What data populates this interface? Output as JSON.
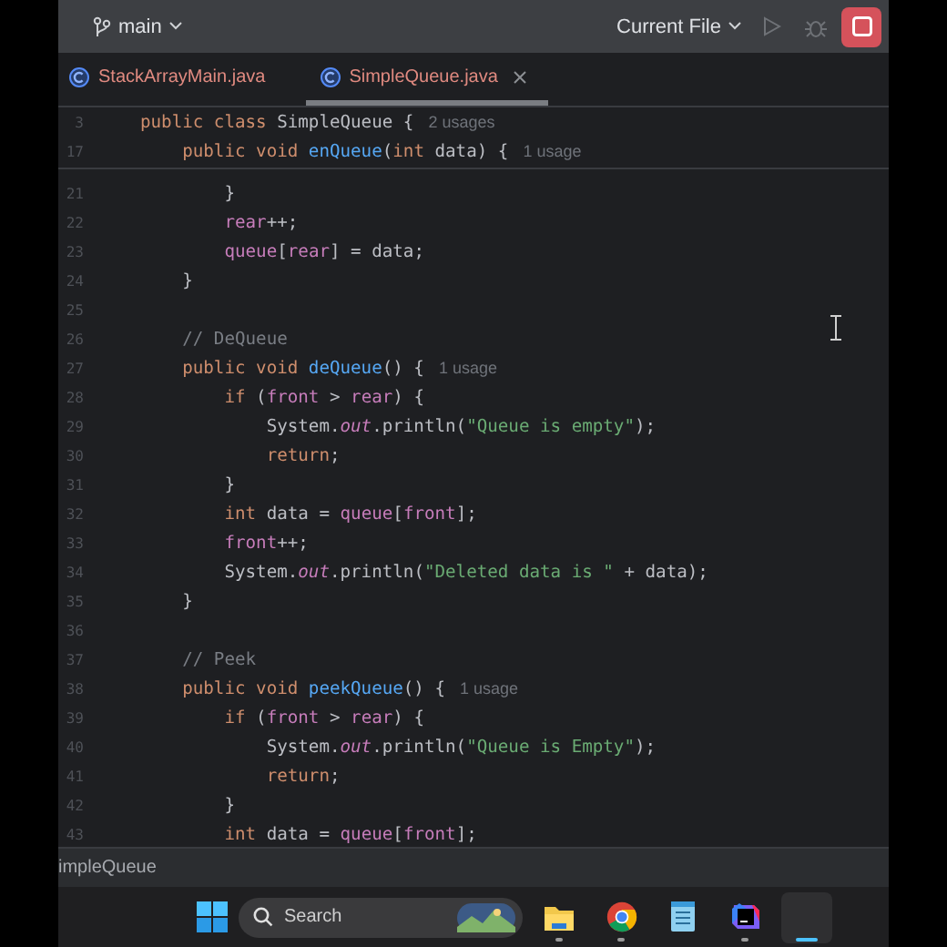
{
  "toolbar": {
    "branch": "main",
    "run_config": "Current File"
  },
  "tabs": [
    {
      "label": "StackArrayMain.java",
      "selected": false
    },
    {
      "label": "SimpleQueue.java",
      "selected": true
    }
  ],
  "sticky_lines": [
    {
      "number": "3",
      "tokens": [
        {
          "kind": "keyword",
          "text": "public class "
        },
        {
          "kind": "plain",
          "text": "SimpleQueue {"
        }
      ],
      "hint": "2 usages"
    },
    {
      "number": "17",
      "tokens": [
        {
          "kind": "keyword",
          "text": "    public void "
        },
        {
          "kind": "method",
          "text": "enQueue"
        },
        {
          "kind": "plain",
          "text": "("
        },
        {
          "kind": "keyword",
          "text": "int "
        },
        {
          "kind": "plain",
          "text": "data) {"
        }
      ],
      "hint": "1 usage"
    }
  ],
  "lines": [
    {
      "number": "21",
      "tokens": [
        {
          "kind": "plain",
          "text": "        }"
        }
      ]
    },
    {
      "number": "22",
      "tokens": [
        {
          "kind": "field",
          "text": "        rear"
        },
        {
          "kind": "plain",
          "text": "++;"
        }
      ]
    },
    {
      "number": "23",
      "tokens": [
        {
          "kind": "field",
          "text": "        queue"
        },
        {
          "kind": "plain",
          "text": "["
        },
        {
          "kind": "field",
          "text": "rear"
        },
        {
          "kind": "plain",
          "text": "] = data;"
        }
      ]
    },
    {
      "number": "24",
      "tokens": [
        {
          "kind": "plain",
          "text": "    }"
        }
      ]
    },
    {
      "number": "25"
    },
    {
      "number": "26",
      "tokens": [
        {
          "kind": "comment",
          "text": "    // DeQueue"
        }
      ]
    },
    {
      "number": "27",
      "tokens": [
        {
          "kind": "keyword",
          "text": "    public void "
        },
        {
          "kind": "method",
          "text": "deQueue"
        },
        {
          "kind": "plain",
          "text": "() {"
        }
      ],
      "hint": "1 usage"
    },
    {
      "number": "28",
      "tokens": [
        {
          "kind": "keyword",
          "text": "        if "
        },
        {
          "kind": "plain",
          "text": "("
        },
        {
          "kind": "field",
          "text": "front"
        },
        {
          "kind": "plain",
          "text": " > "
        },
        {
          "kind": "field",
          "text": "rear"
        },
        {
          "kind": "plain",
          "text": ") {"
        }
      ]
    },
    {
      "number": "29",
      "tokens": [
        {
          "kind": "plain",
          "text": "            System."
        },
        {
          "kind": "static",
          "text": "out"
        },
        {
          "kind": "plain",
          "text": ".println("
        },
        {
          "kind": "string",
          "text": "\"Queue is empty\""
        },
        {
          "kind": "plain",
          "text": ");"
        }
      ]
    },
    {
      "number": "30",
      "tokens": [
        {
          "kind": "keyword",
          "text": "            return"
        },
        {
          "kind": "plain",
          "text": ";"
        }
      ]
    },
    {
      "number": "31",
      "tokens": [
        {
          "kind": "plain",
          "text": "        }"
        }
      ]
    },
    {
      "number": "32",
      "tokens": [
        {
          "kind": "keyword",
          "text": "        int "
        },
        {
          "kind": "plain",
          "text": "data = "
        },
        {
          "kind": "field",
          "text": "queue"
        },
        {
          "kind": "plain",
          "text": "["
        },
        {
          "kind": "field",
          "text": "front"
        },
        {
          "kind": "plain",
          "text": "];"
        }
      ]
    },
    {
      "number": "33",
      "tokens": [
        {
          "kind": "field",
          "text": "        front"
        },
        {
          "kind": "plain",
          "text": "++;"
        }
      ]
    },
    {
      "number": "34",
      "tokens": [
        {
          "kind": "plain",
          "text": "        System."
        },
        {
          "kind": "static",
          "text": "out"
        },
        {
          "kind": "plain",
          "text": ".println("
        },
        {
          "kind": "string",
          "text": "\"Deleted data is \""
        },
        {
          "kind": "plain",
          "text": " + data);"
        }
      ]
    },
    {
      "number": "35",
      "tokens": [
        {
          "kind": "plain",
          "text": "    }"
        }
      ]
    },
    {
      "number": "36"
    },
    {
      "number": "37",
      "tokens": [
        {
          "kind": "comment",
          "text": "    // Peek"
        }
      ]
    },
    {
      "number": "38",
      "tokens": [
        {
          "kind": "keyword",
          "text": "    public void "
        },
        {
          "kind": "method",
          "text": "peekQueue"
        },
        {
          "kind": "plain",
          "text": "() {"
        }
      ],
      "hint": "1 usage"
    },
    {
      "number": "39",
      "tokens": [
        {
          "kind": "keyword",
          "text": "        if "
        },
        {
          "kind": "plain",
          "text": "("
        },
        {
          "kind": "field",
          "text": "front"
        },
        {
          "kind": "plain",
          "text": " > "
        },
        {
          "kind": "field",
          "text": "rear"
        },
        {
          "kind": "plain",
          "text": ") {"
        }
      ]
    },
    {
      "number": "40",
      "tokens": [
        {
          "kind": "plain",
          "text": "            System."
        },
        {
          "kind": "static",
          "text": "out"
        },
        {
          "kind": "plain",
          "text": ".println("
        },
        {
          "kind": "string",
          "text": "\"Queue is Empty\""
        },
        {
          "kind": "plain",
          "text": ");"
        }
      ]
    },
    {
      "number": "41",
      "tokens": [
        {
          "kind": "keyword",
          "text": "            return"
        },
        {
          "kind": "plain",
          "text": ";"
        }
      ]
    },
    {
      "number": "42",
      "tokens": [
        {
          "kind": "plain",
          "text": "        }"
        }
      ]
    },
    {
      "number": "43",
      "tokens": [
        {
          "kind": "keyword",
          "text": "        int "
        },
        {
          "kind": "plain",
          "text": "data = "
        },
        {
          "kind": "field",
          "text": "queue"
        },
        {
          "kind": "plain",
          "text": "["
        },
        {
          "kind": "field",
          "text": "front"
        },
        {
          "kind": "plain",
          "text": "];"
        }
      ]
    }
  ],
  "status_bar": {
    "breadcrumb": "impleQueue"
  },
  "taskbar": {
    "search": {
      "placeholder": "Search"
    },
    "apps": [
      {
        "kind": "explorer",
        "running": true,
        "selected": false
      },
      {
        "kind": "browser",
        "running": true,
        "selected": false
      },
      {
        "kind": "notepad",
        "running": false,
        "selected": false
      },
      {
        "kind": "ide",
        "running": true,
        "selected": false
      },
      {
        "kind": "blank",
        "running": true,
        "selected": true
      }
    ]
  }
}
